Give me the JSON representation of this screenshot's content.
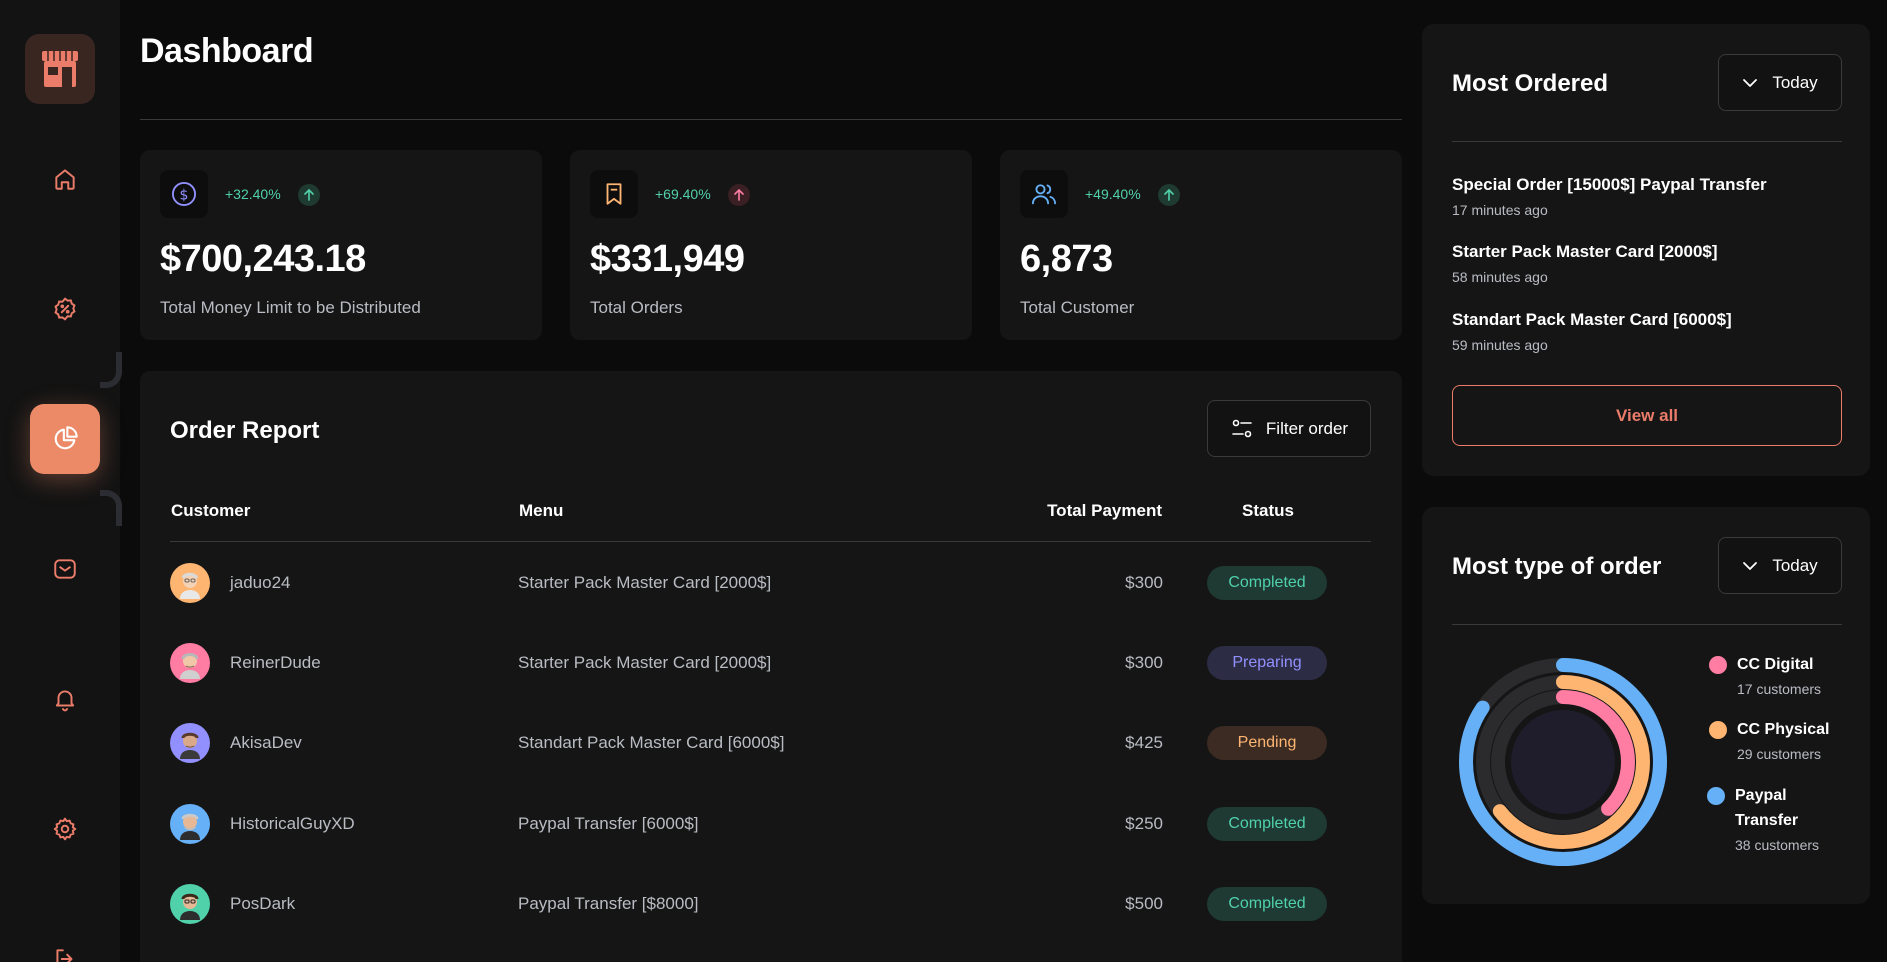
{
  "page": {
    "title": "Dashboard"
  },
  "sidebar": {
    "logo": "store-icon",
    "items": [
      {
        "name": "home",
        "icon": "home-icon"
      },
      {
        "name": "discount",
        "icon": "discount-icon"
      },
      {
        "name": "dashboard",
        "icon": "pie-chart-icon",
        "active": true
      },
      {
        "name": "messages",
        "icon": "message-icon"
      },
      {
        "name": "notifications",
        "icon": "bell-icon"
      },
      {
        "name": "settings",
        "icon": "gear-icon"
      },
      {
        "name": "logout",
        "icon": "logout-icon"
      }
    ]
  },
  "stats": [
    {
      "icon": "dollar-icon",
      "change": "+32.40%",
      "trend": "up",
      "value": "$700,243.18",
      "label": "Total Money Limit to be Distributed"
    },
    {
      "icon": "bookmark-icon",
      "change": "+69.40%",
      "trend": "up",
      "value": "$331,949",
      "label": "Total Orders"
    },
    {
      "icon": "customers-icon",
      "change": "+49.40%",
      "trend": "up",
      "value": "6,873",
      "label": "Total Customer"
    }
  ],
  "order_report": {
    "title": "Order Report",
    "filter_label": "Filter order",
    "columns": {
      "customer": "Customer",
      "menu": "Menu",
      "payment": "Total Payment",
      "status": "Status"
    },
    "rows": [
      {
        "customer": "jaduo24",
        "menu": "Starter Pack Master Card [2000$]",
        "payment": "$300",
        "status": "Completed",
        "avatar_color": "#ffb572"
      },
      {
        "customer": "ReinerDude",
        "menu": "Starter Pack Master Card [2000$]",
        "payment": "$300",
        "status": "Preparing",
        "avatar_color": "#ff7ca3"
      },
      {
        "customer": "AkisaDev",
        "menu": "Standart Pack Master Card [6000$]",
        "payment": "$425",
        "status": "Pending",
        "avatar_color": "#9290fe"
      },
      {
        "customer": "HistoricalGuyXD",
        "menu": "Paypal Transfer [6000$]",
        "payment": "$250",
        "status": "Completed",
        "avatar_color": "#65b0f6"
      },
      {
        "customer": "PosDark",
        "menu": "Paypal Transfer [$8000]",
        "payment": "$500",
        "status": "Completed",
        "avatar_color": "#50d1aa"
      }
    ]
  },
  "most_ordered": {
    "title": "Most Ordered",
    "dropdown": "Today",
    "items": [
      {
        "title": "Special Order [15000$] Paypal Transfer",
        "time": "17 minutes ago"
      },
      {
        "title": "Starter Pack Master Card [2000$]",
        "time": "58 minutes ago"
      },
      {
        "title": "Standart Pack Master Card [6000$]",
        "time": "59 minutes ago"
      }
    ],
    "view_all": "View all"
  },
  "most_type": {
    "title": "Most type of order",
    "dropdown": "Today",
    "legend": [
      {
        "name": "CC Digital",
        "count": "17 customers",
        "color": "#ff7ca3"
      },
      {
        "name": "CC Physical",
        "count": "29 customers",
        "color": "#ffb572"
      },
      {
        "name": "Paypal Transfer",
        "name_line1": "Paypal",
        "name_line2": "Transfer",
        "count": "38 customers",
        "color": "#65b0f6"
      }
    ]
  },
  "chart_data": {
    "type": "pie",
    "categories": [
      "CC Digital",
      "CC Physical",
      "Paypal Transfer"
    ],
    "values": [
      17,
      29,
      38
    ],
    "colors": [
      "#ff7ca3",
      "#ffb572",
      "#65b0f6"
    ]
  }
}
